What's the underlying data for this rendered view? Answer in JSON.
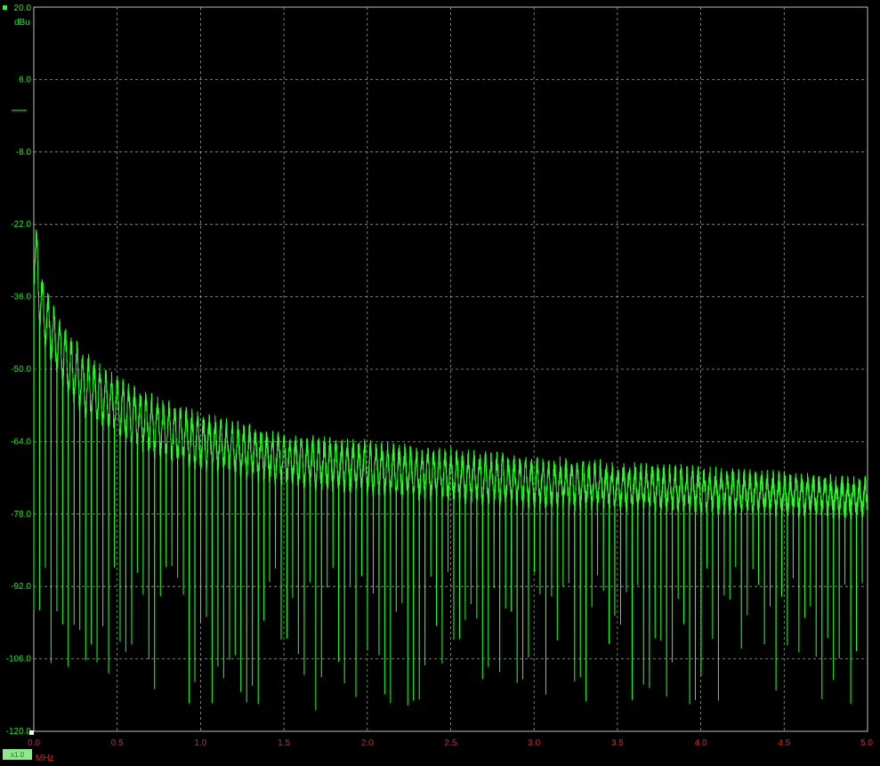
{
  "chart_data": {
    "type": "line",
    "xlabel": "MHz",
    "ylabel": "dBu",
    "xlim": [
      0.0,
      5.0
    ],
    "ylim": [
      -120.0,
      20.0
    ],
    "x_ticks": [
      "0.0",
      "0.5",
      "1.0",
      "1.5",
      "2.0",
      "2.5",
      "3.0",
      "3.5",
      "4.0",
      "4.5",
      "5.0"
    ],
    "y_ticks": [
      "20.0",
      "6.0",
      "-8.0",
      "-22.0",
      "-36.0",
      "-50.0",
      "-64.0",
      "-78.0",
      "-92.0",
      "-106.0",
      "-120.0"
    ],
    "grid": true,
    "series": [
      {
        "color": "#22ff22",
        "description_points": {
          "x": [
            0.0,
            0.05,
            0.1,
            0.2,
            0.3,
            0.5,
            0.75,
            1.0,
            1.5,
            2.0,
            2.5,
            3.0,
            3.5,
            4.0,
            4.5,
            5.0
          ],
          "peak": [
            -20.0,
            -33.0,
            -38.0,
            -44.0,
            -48.0,
            -53.0,
            -57.0,
            -60.0,
            -64.0,
            -65.5,
            -67.0,
            -68.5,
            -69.5,
            -70.5,
            -71.5,
            -72.5
          ],
          "trough": [
            -33.0,
            -44.0,
            -47.0,
            -54.0,
            -58.0,
            -62.0,
            -66.0,
            -68.0,
            -71.0,
            -73.0,
            -74.5,
            -75.5,
            -76.0,
            -76.5,
            -77.0,
            -77.5
          ]
        }
      }
    ]
  },
  "markers": {
    "channel_badge": "x1.0"
  },
  "colors": {
    "trace": "#22ff22",
    "y_axis_text": "#1fe81f",
    "x_axis_text": "#e02020",
    "grid": "#9a9a9a",
    "background": "#000000"
  }
}
